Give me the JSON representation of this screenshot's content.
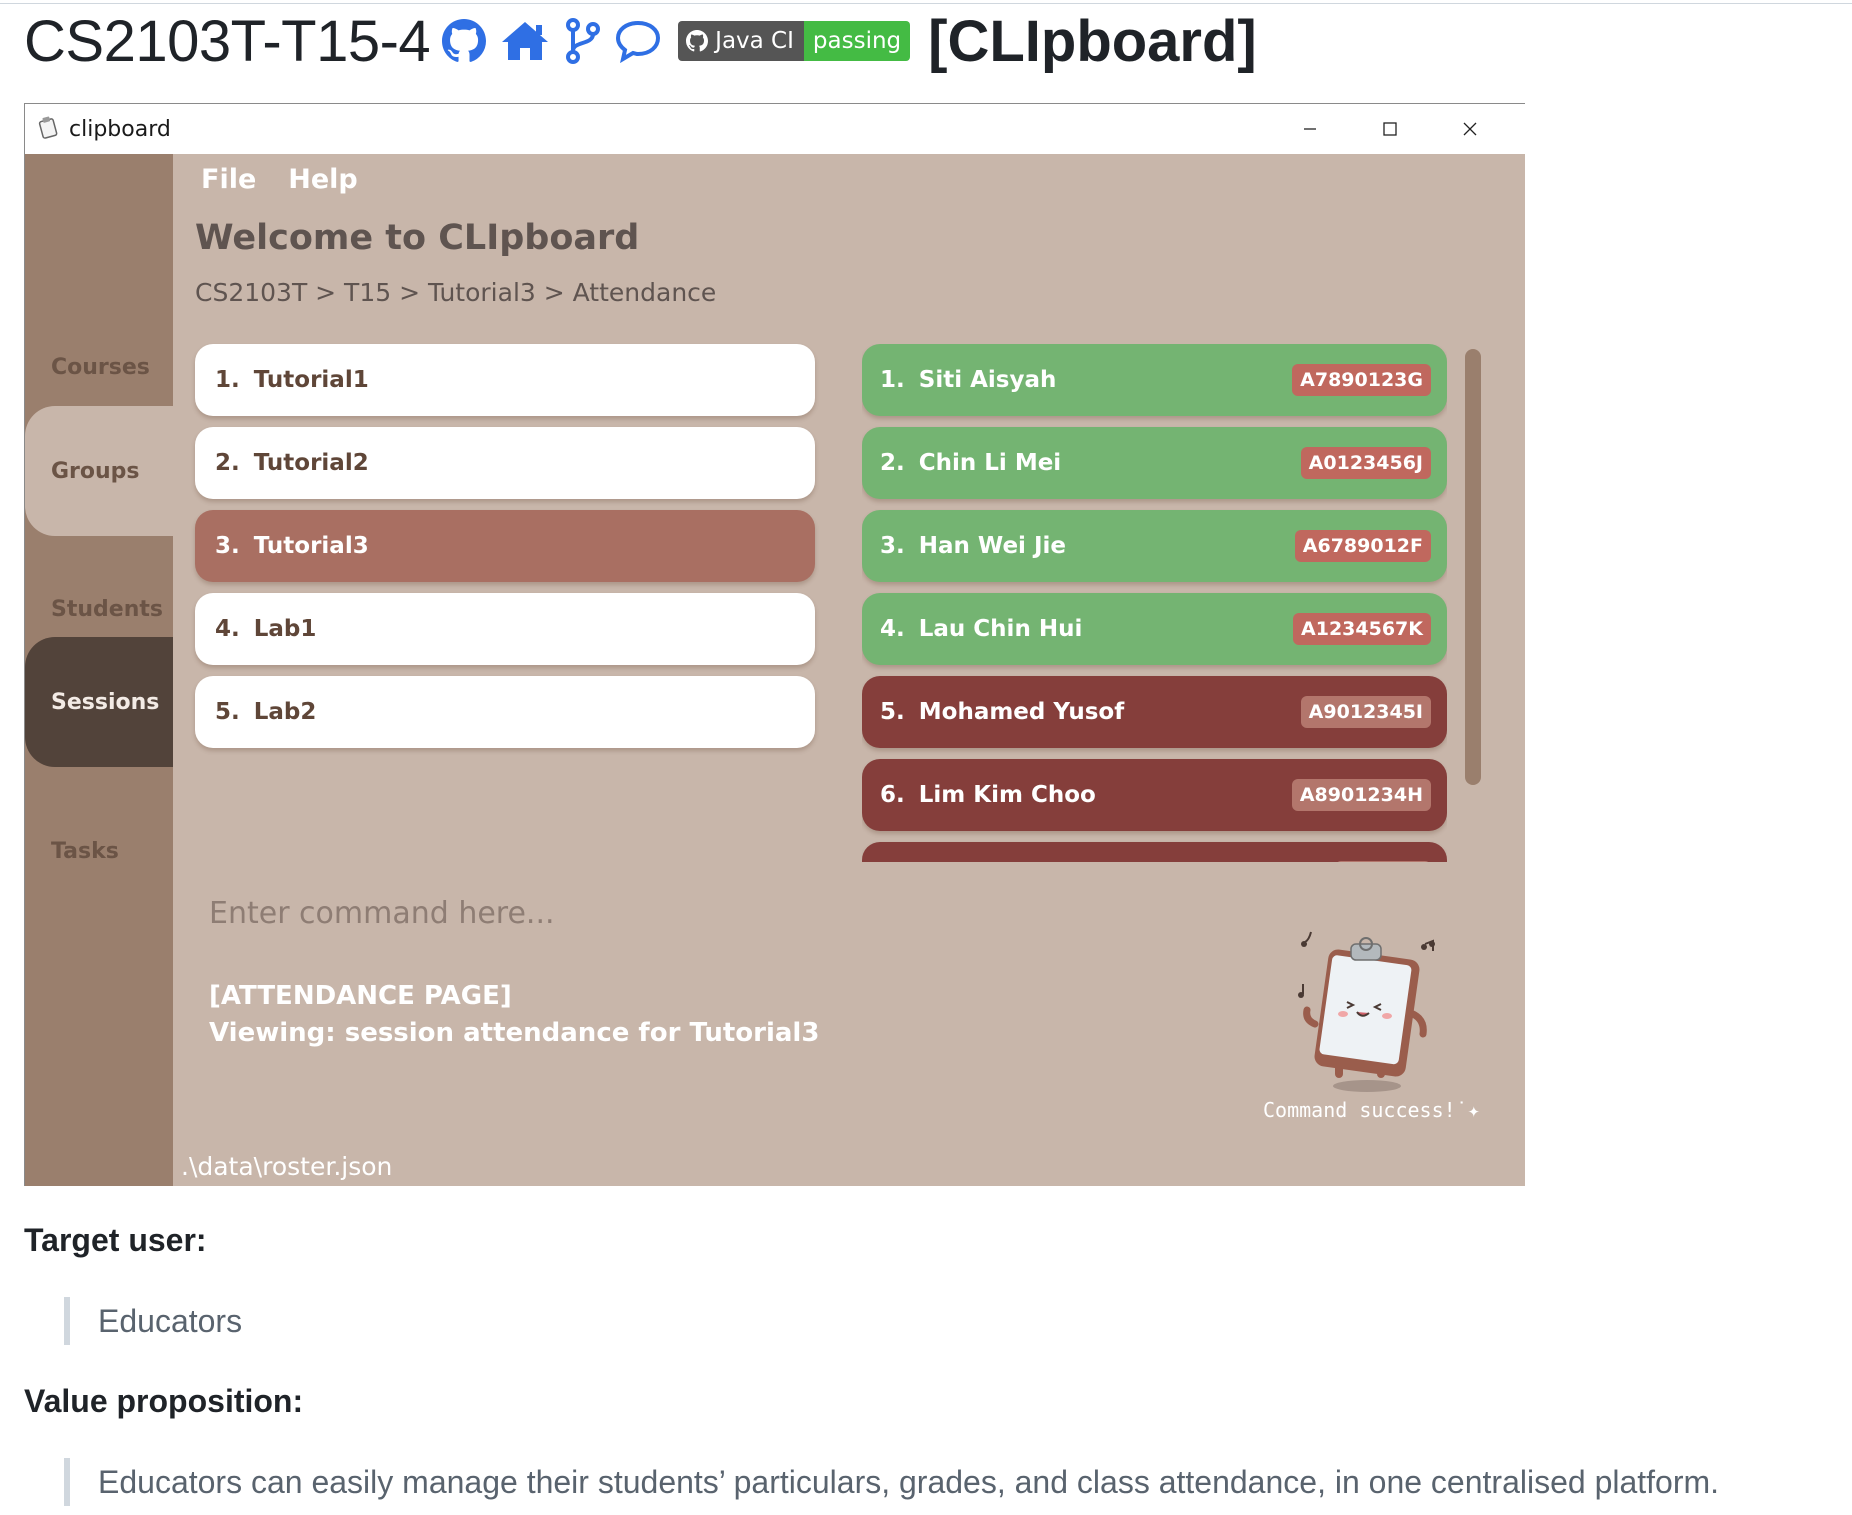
{
  "readme": {
    "repo_name": "CS2103T-T15-4",
    "badge": {
      "label": "Java CI",
      "status": "passing"
    },
    "project_tag": "[CLIpboard]",
    "target_user_heading": "Target user:",
    "target_user": "Educators",
    "value_heading": "Value proposition:",
    "value": "Educators can easily manage their students’ particulars, grades, and class attendance, in one centralised platform.",
    "header_icons": [
      "github-icon",
      "home-icon",
      "git-branch-icon",
      "chat-bubble-icon"
    ]
  },
  "window": {
    "title": "clipboard",
    "controls": [
      "minimize-icon",
      "maximize-icon",
      "close-icon"
    ]
  },
  "menu": {
    "file": "File",
    "help": "Help"
  },
  "sidebar": {
    "items": [
      {
        "label": "Courses",
        "active": false
      },
      {
        "label": "Groups",
        "active": false
      },
      {
        "label": "Students",
        "active": false
      },
      {
        "label": "Sessions",
        "active": true
      },
      {
        "label": "Tasks",
        "active": false
      }
    ]
  },
  "main": {
    "welcome": "Welcome to CLIpboard",
    "breadcrumb": "CS2103T > T15 > Tutorial3 > Attendance",
    "sessions": [
      {
        "num": "1.",
        "name": "Tutorial1",
        "selected": false
      },
      {
        "num": "2.",
        "name": "Tutorial2",
        "selected": false
      },
      {
        "num": "3.",
        "name": "Tutorial3",
        "selected": true
      },
      {
        "num": "4.",
        "name": "Lab1",
        "selected": false
      },
      {
        "num": "5.",
        "name": "Lab2",
        "selected": false
      }
    ],
    "students": [
      {
        "num": "1.",
        "name": "Siti Aisyah",
        "id": "A7890123G",
        "present": true
      },
      {
        "num": "2.",
        "name": "Chin Li Mei",
        "id": "A0123456J",
        "present": true
      },
      {
        "num": "3.",
        "name": "Han Wei Jie",
        "id": "A6789012F",
        "present": true
      },
      {
        "num": "4.",
        "name": "Lau Chin Hui",
        "id": "A1234567K",
        "present": true
      },
      {
        "num": "5.",
        "name": "Mohamed Yusof",
        "id": "A9012345I",
        "present": false
      },
      {
        "num": "6.",
        "name": "Lim Kim Choo",
        "id": "A8901234H",
        "present": false
      },
      {
        "num": "",
        "name": "",
        "id": "",
        "present": false
      }
    ]
  },
  "command": {
    "placeholder": "Enter command here...",
    "result_line1": "[ATTENDANCE PAGE]",
    "result_line2": "Viewing: session attendance for Tutorial3",
    "mascot_caption": "Command success!˙✦"
  },
  "status_bar": {
    "path": ".\\data\\roster.json"
  },
  "colors": {
    "present": "#74b472",
    "present_id": "#c0685e",
    "absent": "#853e3b",
    "absent_id": "#b3766c",
    "selected_session": "#a96f62",
    "sidebar": "#9a7f6d",
    "background": "#c8b6aa"
  }
}
